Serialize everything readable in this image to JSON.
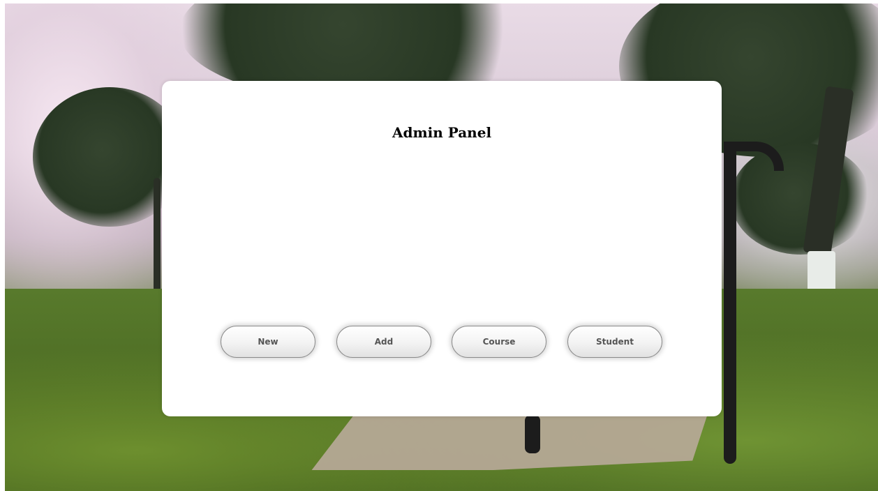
{
  "panel": {
    "title": "Admin Panel"
  },
  "buttons": [
    {
      "label": "New"
    },
    {
      "label": "Add"
    },
    {
      "label": "Course"
    },
    {
      "label": "Student"
    }
  ],
  "colors": {
    "panel_background": "#ffffff",
    "title_text": "#000000",
    "button_text": "#555555"
  }
}
